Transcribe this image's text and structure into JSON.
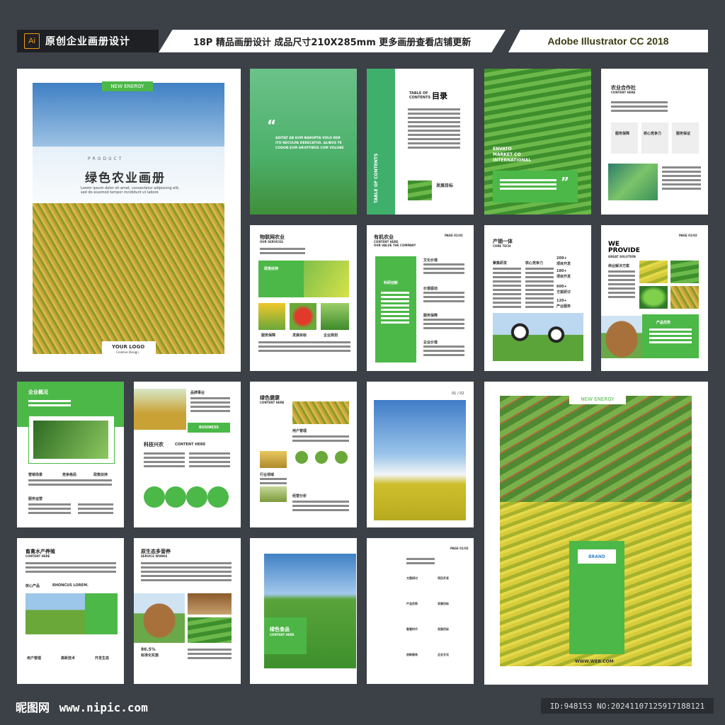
{
  "header": {
    "ai_badge": "Ai",
    "left_title": "原创企业画册设计",
    "mid_title": "18P 精品画册设计 成品尺寸210X285mm 更多画册查看店铺更新",
    "right_title": "Adobe Illustrator CC 2018"
  },
  "cover": {
    "tag": "NEW ENERGY",
    "product": "PRODUCT",
    "title": "绿色农业画册",
    "lorem": "Lorem ipsum dolor sit amet, consectetur adipiscing elit, sed do eiusmod tempor incididunt ut labore",
    "logo": "YOUR LOGO",
    "logo_sub": "Creative Design"
  },
  "p2": {
    "quote": "“",
    "text": "ADITAT AB EUM NARUPTA VOLO DER ITO NECULPA DERECATUS. ALIBUS TE CODON EUM ARUPTIBUS CUM VOLOBE"
  },
  "p3": {
    "side": "TABLE OF CONTENTS",
    "toc_en": "TABLE OF CONTENTS",
    "toc_cn": "目录",
    "bottom": "发展目标"
  },
  "p4": {
    "text1": "ENVATO",
    "text2": "MARKET CO",
    "text3": "INTERNATIONAL",
    "quote": "”"
  },
  "p5": {
    "title": "农业合作社",
    "sub": "CONTENT HERE",
    "items": [
      "服务保障",
      "核心竞争力",
      "服务保证"
    ]
  },
  "p6": {
    "title": "物联网农业",
    "sub": "OUR SERVICES",
    "badge": "政策扶持",
    "labels": [
      "服务保障",
      "发展目标",
      "企业规划"
    ]
  },
  "p7": {
    "title": "有机农业",
    "sub1": "CONTENT HERE",
    "sub2": "OUR VALUE THE COMPANY",
    "page": "PAGE 01/02",
    "side": "科研创新",
    "items": [
      "文化价值",
      "价值驱动",
      "服务保障",
      "企业价值"
    ]
  },
  "p8": {
    "title": "产销一体",
    "sub": "CORE TECH",
    "col1": "聚集研发",
    "col2": "核心竞争力",
    "stats": [
      "200+",
      "180+",
      "600+",
      "120+"
    ],
    "stat_labels": [
      "项目开发",
      "项目开发",
      "方案研讨",
      "产业服务"
    ]
  },
  "p9": {
    "title1": "WE",
    "title2": "PROVIDE",
    "sub": "GREAT SOLUTION",
    "page": "PAGE 01/02",
    "left": "商业解决方案",
    "badge": "产品优势"
  },
  "p10": {
    "title": "企业概况",
    "labels": [
      "营销场景",
      "竞争格局",
      "政策扶持",
      "服务运营"
    ]
  },
  "p11": {
    "label1": "品牌事业",
    "badge": "BUSINESS",
    "title": "科技兴农",
    "sub": "CONTENT HERE"
  },
  "p12": {
    "title": "绿色健康",
    "sub": "CONTENT HERE",
    "labels": [
      "用户管理",
      "行业领域",
      "经营分析"
    ]
  },
  "p13": {
    "page": "01 / 02"
  },
  "p14": {
    "tag": "NEW ENERGY",
    "brand": "BRAND",
    "url": "WWW.WEB.COM"
  },
  "p15": {
    "title": "畜禽水产养殖",
    "sub": "CONTENT HERE",
    "label": "核心产品",
    "label2": "RHONCUS LOREM.",
    "icons": [
      "用户管理",
      "高新技术",
      "开发生态"
    ]
  },
  "p16": {
    "title": "原生态多营养",
    "sub": "SERVICE WORKS",
    "pct": "86.5%",
    "pct_label": "标准化实施"
  },
  "p17": {
    "title": "绿色食品",
    "sub": "CONTENT HERE"
  },
  "p18": {
    "page": "PAGE 01/02",
    "items": [
      "方案研讨",
      "项目开发",
      "产品优势",
      "发展目标",
      "智慧时代",
      "发展目标",
      "创新服务",
      "企业文化"
    ]
  },
  "footer": {
    "logo": "昵图网",
    "url": "www.nipic.com",
    "id": "ID:948153 NO:20241107125917188121"
  }
}
